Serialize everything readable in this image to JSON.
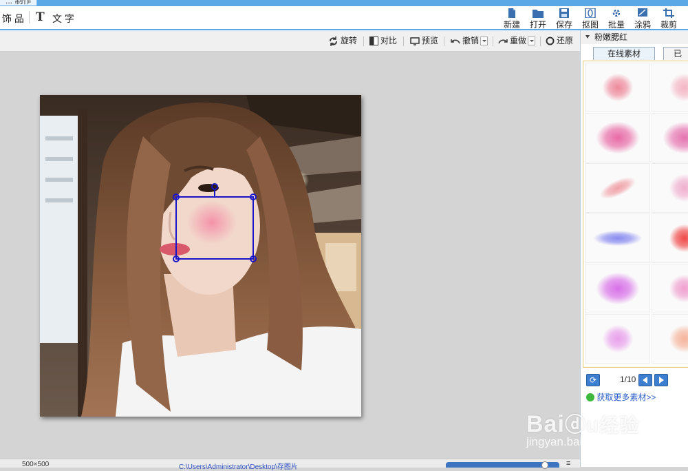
{
  "window": {
    "title_tab": "... 制作"
  },
  "toolbar": {
    "left_items": [
      "饰 品",
      "文 字"
    ],
    "text_tool_glyph": "T",
    "buttons": [
      {
        "label": "新建",
        "icon": "new-file-icon"
      },
      {
        "label": "打开",
        "icon": "open-folder-icon"
      },
      {
        "label": "保存",
        "icon": "save-icon"
      },
      {
        "label": "抠图",
        "icon": "cutout-icon"
      },
      {
        "label": "批量",
        "icon": "batch-icon"
      },
      {
        "label": "涂鸦",
        "icon": "doodle-icon"
      },
      {
        "label": "裁剪",
        "icon": "crop-icon"
      }
    ]
  },
  "subbar": {
    "rotate": "旋转",
    "compare": "对比",
    "preview": "预览",
    "undo": "撤销",
    "redo": "重做",
    "restore": "还原"
  },
  "status": {
    "dimensions": "500×500",
    "path": "C:\\Users\\Administrator\\Desktop\\存图片"
  },
  "panel": {
    "section_title": "粉嫩腮红",
    "tabs": [
      "在线素材",
      "已"
    ],
    "page": "1/10",
    "more_link": "获取更多素材>>",
    "materials": [
      {
        "color": "#ee8a9c",
        "shape": "round-soft"
      },
      {
        "color": "#f4b6c4",
        "shape": "round-soft"
      },
      {
        "color": "#e86aa6",
        "shape": "oval-large"
      },
      {
        "color": "#e574b0",
        "shape": "oval-large"
      },
      {
        "color": "#f0a2a8",
        "shape": "streak"
      },
      {
        "color": "#f0b0d0",
        "shape": "round-soft"
      },
      {
        "color": "#8a8cf0",
        "shape": "arc"
      },
      {
        "color": "#f04848",
        "shape": "round-soft"
      },
      {
        "color": "#d870e8",
        "shape": "oval-large"
      },
      {
        "color": "#f0a0d0",
        "shape": "round-soft"
      },
      {
        "color": "#e8a0ec",
        "shape": "round-soft"
      },
      {
        "color": "#f6b49c",
        "shape": "round-soft"
      }
    ]
  },
  "watermark": {
    "brand": "Bai",
    "brand_cn": "经验",
    "url": "jingyan.baidu.com"
  },
  "colors": {
    "accent": "#5aa9e6",
    "selection": "#1a14c8",
    "blush": "#f48fa8"
  }
}
